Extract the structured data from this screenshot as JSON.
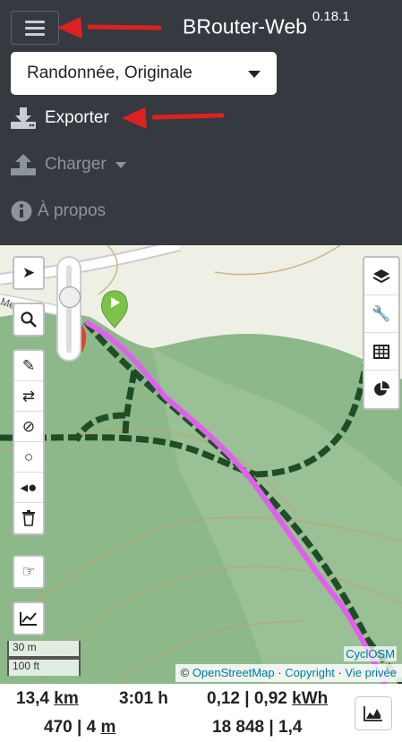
{
  "header": {
    "brand_name": "BRouter-Web",
    "version": "0.18.1",
    "profile_select": "Randonnée, Originale",
    "menu": {
      "export": "Exporter",
      "load": "Charger",
      "about": "À propos"
    }
  },
  "map": {
    "road_label": "Merlière",
    "layer_name": "CyclOSM",
    "scale": {
      "metric": "30 m",
      "imperial": "100 ft"
    },
    "attribution": {
      "copyright": "©",
      "osm": "OpenStreetMap",
      "sep1": "·",
      "copyright_link": "Copyright",
      "sep2": "·",
      "privacy": "Vie privée"
    }
  },
  "stats": {
    "distance_value": "13,4",
    "distance_unit": "km",
    "time": "3:01 h",
    "energy_a": "0,12",
    "energy_b": "0,92",
    "energy_unit": "kWh",
    "ascent": "470",
    "descent_value": "4",
    "descent_unit": "m",
    "cost": "18 848",
    "mean_cost": "1,4"
  },
  "colors": {
    "route": "#e060ee",
    "topbar": "#343a40",
    "forest": "#8db88a"
  }
}
